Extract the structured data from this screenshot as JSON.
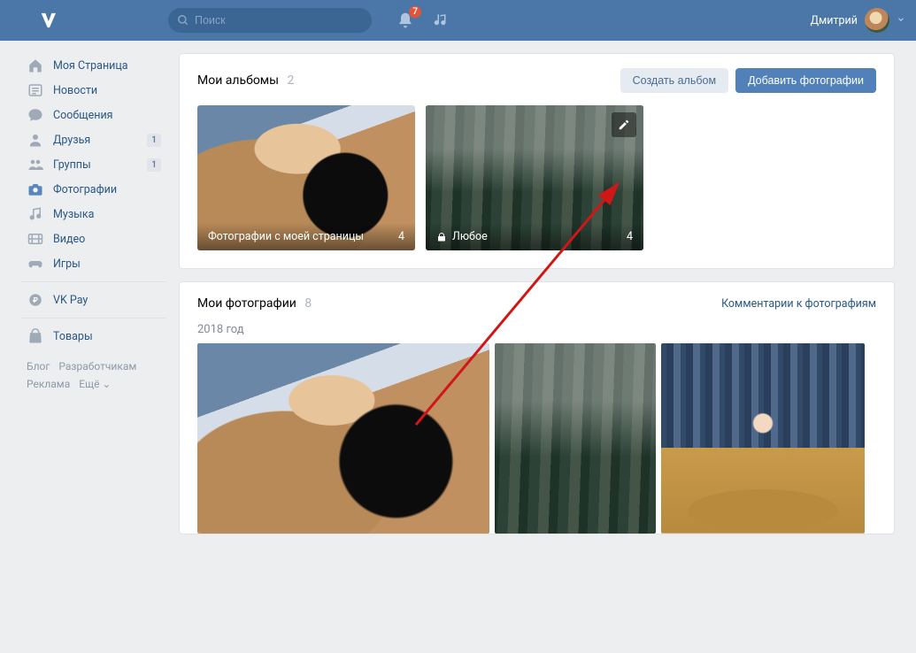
{
  "header": {
    "search_placeholder": "Поиск",
    "notif_badge": "7",
    "user_name": "Дмитрий"
  },
  "sidebar": {
    "items": [
      {
        "label": "Моя Страница",
        "icon": "home"
      },
      {
        "label": "Новости",
        "icon": "news"
      },
      {
        "label": "Сообщения",
        "icon": "messages"
      },
      {
        "label": "Друзья",
        "icon": "friends",
        "count": "1"
      },
      {
        "label": "Группы",
        "icon": "groups",
        "count": "1"
      },
      {
        "label": "Фотографии",
        "icon": "photos",
        "active": true
      },
      {
        "label": "Музыка",
        "icon": "music"
      },
      {
        "label": "Видео",
        "icon": "video"
      },
      {
        "label": "Игры",
        "icon": "games"
      }
    ],
    "items2": [
      {
        "label": "VK Pay",
        "icon": "pay"
      }
    ],
    "items3": [
      {
        "label": "Товары",
        "icon": "market"
      }
    ],
    "footer": [
      "Блог",
      "Разработчикам",
      "Реклама",
      "Ещё ⌄"
    ]
  },
  "albums": {
    "title": "Мои альбомы",
    "count": "2",
    "create_btn": "Создать альбом",
    "add_btn": "Добавить фотографии",
    "items": [
      {
        "name": "Фотографии с моей страницы",
        "count": "4",
        "locked": false
      },
      {
        "name": "Любое",
        "count": "4",
        "locked": true,
        "edit": true
      }
    ]
  },
  "photos": {
    "title": "Мои фотографии",
    "count": "8",
    "comments_link": "Комментарии к фотографиям",
    "year_label": "2018 год"
  }
}
